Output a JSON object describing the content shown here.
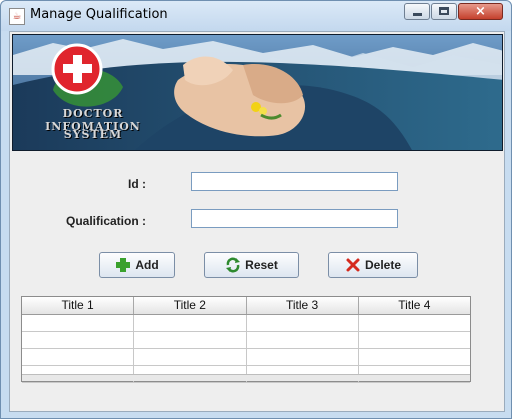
{
  "window": {
    "title": "Manage Qualification",
    "app_icon": "java-icon",
    "controls": {
      "minimize": "minimize-icon",
      "maximize": "maximize-icon",
      "close": "×"
    }
  },
  "banner": {
    "line1": "DOCTOR INFOMATION",
    "line2": "SYSTEM",
    "logo_icon": "red-cross-icon"
  },
  "form": {
    "id_label": "Id :",
    "id_value": "",
    "qualification_label": "Qualification :",
    "qualification_value": ""
  },
  "buttons": {
    "add": "Add",
    "reset": "Reset",
    "delete": "Delete"
  },
  "table": {
    "columns": [
      "Title 1",
      "Title 2",
      "Title 3",
      "Title 4"
    ],
    "rows": [
      [
        "",
        "",
        "",
        ""
      ],
      [
        "",
        "",
        "",
        ""
      ],
      [
        "",
        "",
        "",
        ""
      ],
      [
        "",
        "",
        "",
        ""
      ]
    ]
  },
  "colors": {
    "accent_red": "#e0252d",
    "add_green": "#3aa12d",
    "delete_red": "#d52a1e",
    "banner_blue": "#2b4f78"
  }
}
